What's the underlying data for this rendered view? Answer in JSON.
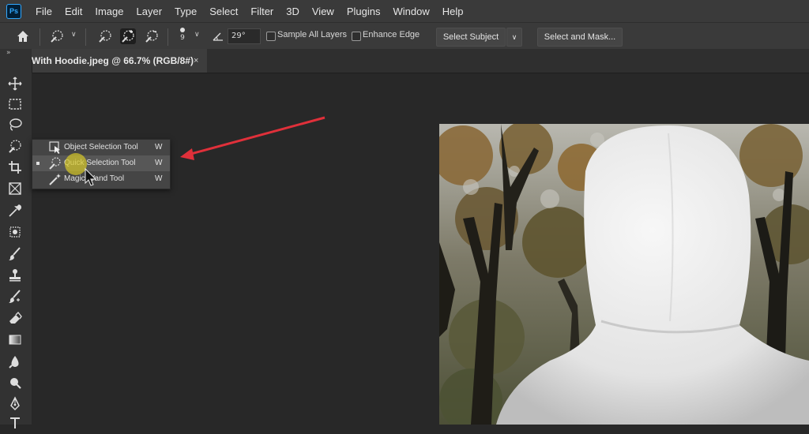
{
  "app": {
    "logo": "Ps"
  },
  "menu": [
    "File",
    "Edit",
    "Image",
    "Layer",
    "Type",
    "Select",
    "Filter",
    "3D",
    "View",
    "Plugins",
    "Window",
    "Help"
  ],
  "options": {
    "brush_size": "9",
    "angle": "29°",
    "sample_all_layers": "Sample All Layers",
    "enhance_edge": "Enhance Edge",
    "select_subject": "Select Subject",
    "select_and_mask": "Select and Mask..."
  },
  "panel_collapse": "»",
  "document": {
    "tab_title": "With Hoodie.jpeg @ 66.7% (RGB/8#)",
    "close": "×"
  },
  "flyout": {
    "items": [
      {
        "label": "Object Selection Tool",
        "key": "W"
      },
      {
        "label": "Quick Selection Tool",
        "key": "W"
      },
      {
        "label": "Magic Wand Tool",
        "key": "W"
      }
    ]
  },
  "colors": {
    "accent_arrow": "#e0303a",
    "cursor_highlight": "#d6c828",
    "ps_blue": "#31a8ff"
  },
  "icons": [
    "home-icon",
    "brush-icon",
    "add-brush-icon",
    "subtract-brush-icon",
    "angle-icon",
    "move-icon",
    "marquee-icon",
    "lasso-icon",
    "quick-selection-icon",
    "crop-icon",
    "frame-icon",
    "eyedropper-icon",
    "healing-icon",
    "brush-tool-icon",
    "stamp-icon",
    "history-brush-icon",
    "eraser-icon",
    "gradient-icon",
    "blur-icon",
    "dodge-icon",
    "pen-icon",
    "type-icon"
  ]
}
